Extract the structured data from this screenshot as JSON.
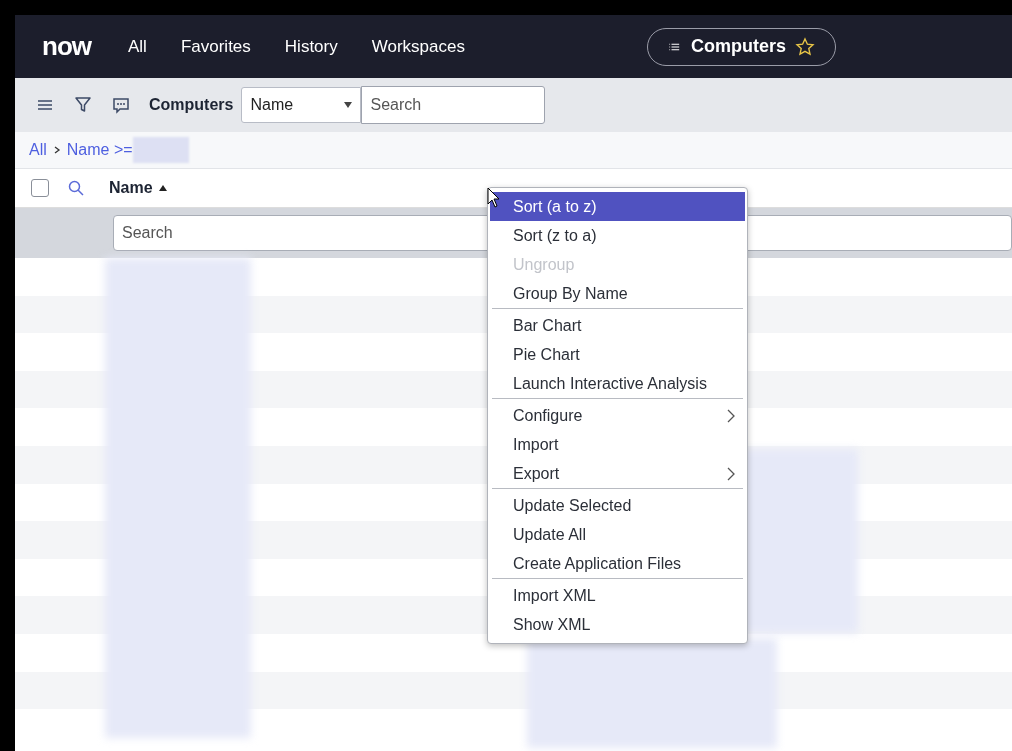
{
  "nav": {
    "logo": "now",
    "links": [
      "All",
      "Favorites",
      "History",
      "Workspaces"
    ],
    "context": {
      "title": "Computers",
      "starred": false
    }
  },
  "toolbar": {
    "title": "Computers",
    "field_select": "Name",
    "search": {
      "placeholder": "Search"
    }
  },
  "breadcrumb": [
    "All",
    "Name >="
  ],
  "table": {
    "select_all": {
      "checked": false
    },
    "columns": [
      {
        "label": "Name",
        "sorted": true
      }
    ],
    "search": {
      "placeholder": "Search"
    }
  },
  "context_menu": {
    "sections": [
      [
        {
          "label": "Sort (a to z)",
          "selected": true,
          "disabled": false,
          "submenu": false
        },
        {
          "label": "Sort (z to a)",
          "selected": false,
          "disabled": false,
          "submenu": false
        },
        {
          "label": "Ungroup",
          "selected": false,
          "disabled": true,
          "submenu": false
        },
        {
          "label": "Group By Name",
          "selected": false,
          "disabled": false,
          "submenu": false
        }
      ],
      [
        {
          "label": "Bar Chart",
          "selected": false,
          "disabled": false,
          "submenu": false
        },
        {
          "label": "Pie Chart",
          "selected": false,
          "disabled": false,
          "submenu": false
        },
        {
          "label": "Launch Interactive Analysis",
          "selected": false,
          "disabled": false,
          "submenu": false
        }
      ],
      [
        {
          "label": "Configure",
          "selected": false,
          "disabled": false,
          "submenu": true
        },
        {
          "label": "Import",
          "selected": false,
          "disabled": false,
          "submenu": false
        },
        {
          "label": "Export",
          "selected": false,
          "disabled": false,
          "submenu": true
        }
      ],
      [
        {
          "label": "Update Selected",
          "selected": false,
          "disabled": false,
          "submenu": false
        },
        {
          "label": "Update All",
          "selected": false,
          "disabled": false,
          "submenu": false
        },
        {
          "label": "Create Application Files",
          "selected": false,
          "disabled": false,
          "submenu": false
        }
      ],
      [
        {
          "label": "Import XML",
          "selected": false,
          "disabled": false,
          "submenu": false
        },
        {
          "label": "Show XML",
          "selected": false,
          "disabled": false,
          "submenu": false
        }
      ]
    ]
  }
}
